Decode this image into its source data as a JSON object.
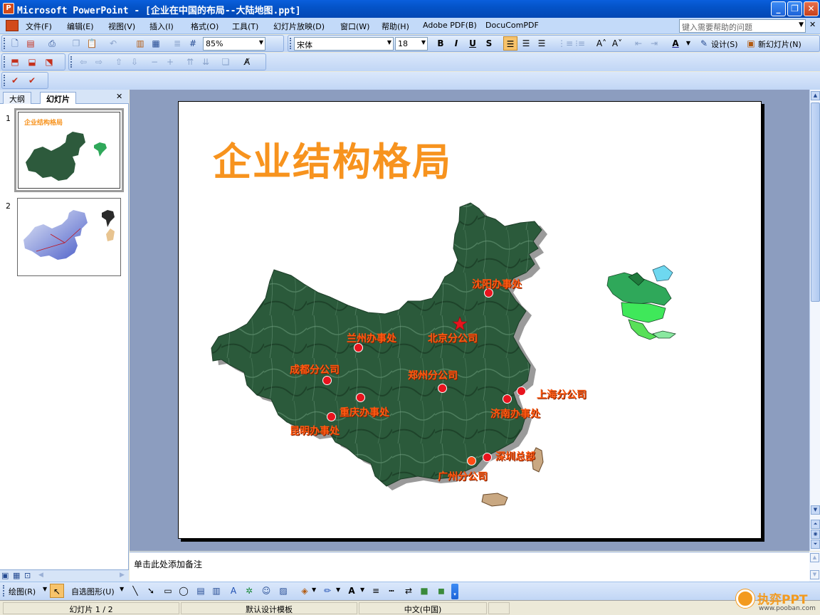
{
  "window": {
    "title": "Microsoft PowerPoint - [企业在中国的布局--大陆地图.ppt]",
    "minimize": "_",
    "restore": "❐",
    "close": "✕"
  },
  "menu": {
    "items": [
      "文件(F)",
      "编辑(E)",
      "视图(V)",
      "插入(I)",
      "格式(O)",
      "工具(T)",
      "幻灯片放映(D)",
      "窗口(W)",
      "帮助(H)",
      "Adobe PDF(B)",
      "DocuComPDF"
    ],
    "help_placeholder": "键入需要帮助的问题",
    "close_doc": "✕"
  },
  "toolbar": {
    "zoom": "85%",
    "font_name": "宋体",
    "font_size": "18",
    "bold": "B",
    "italic": "I",
    "underline": "U",
    "shadow": "S",
    "design": "设计(S)",
    "new_slide": "新幻灯片(N)",
    "font_color_letter": "A"
  },
  "leftpane": {
    "tab_outline": "大纲",
    "tab_slides": "幻灯片",
    "close": "✕",
    "slide_numbers": [
      "1",
      "2"
    ],
    "thumb1_title": "企业结构格局"
  },
  "slide": {
    "title": "企业结构格局",
    "cities": [
      {
        "label": "沈阳办事处"
      },
      {
        "label": "北京分公司"
      },
      {
        "label": "兰州办事处"
      },
      {
        "label": "成都分公司"
      },
      {
        "label": "郑州分公司"
      },
      {
        "label": "上海分公司"
      },
      {
        "label": "重庆办事处"
      },
      {
        "label": "济南办事处"
      },
      {
        "label": "昆明办事处"
      },
      {
        "label": "深圳总部"
      },
      {
        "label": "广州分公司"
      }
    ]
  },
  "notes": {
    "placeholder": "单击此处添加备注"
  },
  "drawbar": {
    "draw": "绘图(R)",
    "autoshapes": "自选图形(U)"
  },
  "status": {
    "slide_counter": "幻灯片 1 / 2",
    "template": "默认设计模板",
    "language": "中文(中国)"
  },
  "watermark": {
    "brand": "执弈PPT",
    "url": "www.pooban.com"
  },
  "colors": {
    "title_orange": "#f7931e",
    "city_label": "#ff5a12",
    "city_dot": "#e8141e",
    "map_green": "#2d5a3c"
  }
}
